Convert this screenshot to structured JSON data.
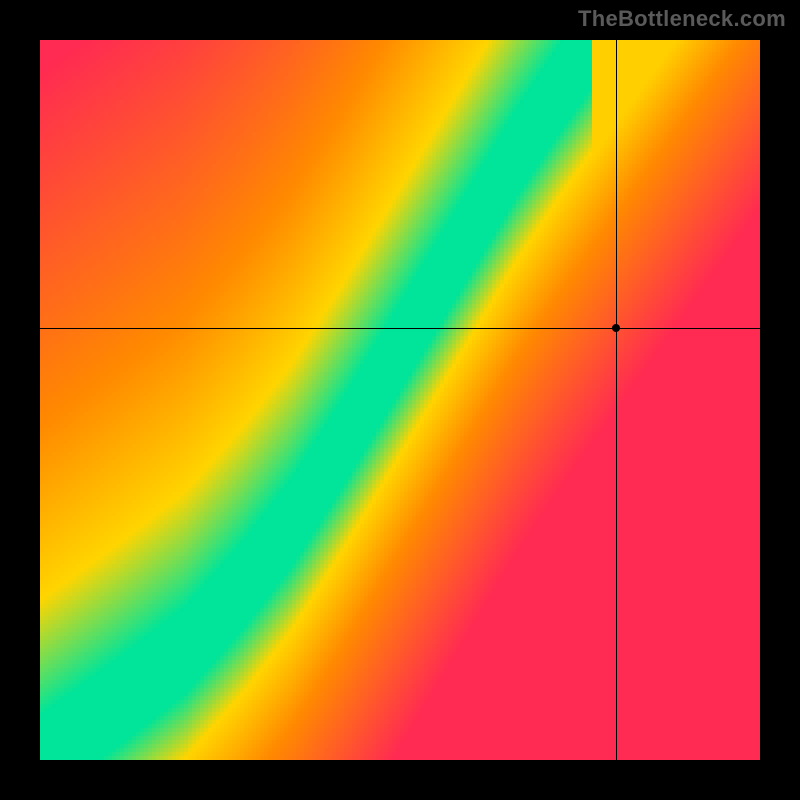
{
  "watermark": "TheBottleneck.com",
  "chart_data": {
    "type": "heatmap",
    "title": "",
    "xlabel": "",
    "ylabel": "",
    "x_range": [
      0,
      100
    ],
    "y_range": [
      0,
      100
    ],
    "crosshair": {
      "x": 80,
      "y": 60
    },
    "marker": {
      "x": 80,
      "y": 60
    },
    "optimal_curve": [
      {
        "x": 0,
        "y": 0
      },
      {
        "x": 11,
        "y": 8
      },
      {
        "x": 20,
        "y": 15
      },
      {
        "x": 28,
        "y": 24
      },
      {
        "x": 35,
        "y": 33
      },
      {
        "x": 42,
        "y": 44
      },
      {
        "x": 48,
        "y": 54
      },
      {
        "x": 54,
        "y": 64
      },
      {
        "x": 60,
        "y": 74
      },
      {
        "x": 66,
        "y": 84
      },
      {
        "x": 72,
        "y": 93
      },
      {
        "x": 77,
        "y": 100
      }
    ],
    "band_halfwidth_y": 6,
    "colors": {
      "good": "#00e59a",
      "mid": "#ffd500",
      "warn": "#ff8a00",
      "bad": "#ff2b52",
      "border": "#000000"
    },
    "resolution": 180
  }
}
